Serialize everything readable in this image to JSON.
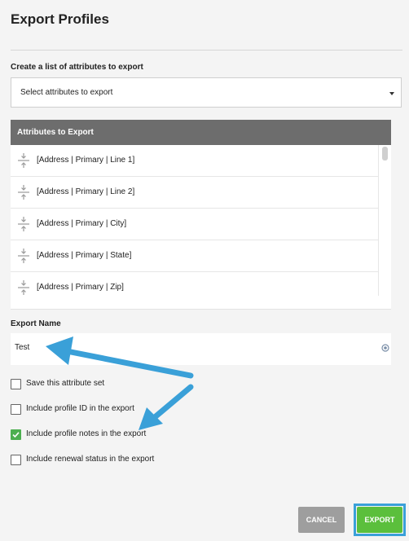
{
  "page": {
    "title": "Export Profiles"
  },
  "attribute_picker": {
    "label": "Create a list of attributes to export",
    "placeholder": "Select attributes to export"
  },
  "attributes_table": {
    "header": "Attributes to Export",
    "rows": [
      {
        "label": "[Address | Primary | Line 1]"
      },
      {
        "label": "[Address | Primary | Line 2]"
      },
      {
        "label": "[Address | Primary | City]"
      },
      {
        "label": "[Address | Primary | State]"
      },
      {
        "label": "[Address | Primary | Zip]"
      }
    ]
  },
  "export_name": {
    "label": "Export Name",
    "value": "Test"
  },
  "options": [
    {
      "label": "Save this attribute set",
      "checked": false
    },
    {
      "label": "Include profile ID in the export",
      "checked": false
    },
    {
      "label": "Include profile notes in the export",
      "checked": true
    },
    {
      "label": "Include renewal status in the export",
      "checked": false
    }
  ],
  "buttons": {
    "cancel": "CANCEL",
    "export": "EXPORT"
  },
  "colors": {
    "table_header": "#6d6d6d",
    "export_button": "#5bbf3c",
    "cancel_button": "#9e9e9e",
    "checkbox_checked": "#4caf50",
    "annotation_arrow": "#3aa0d8"
  }
}
